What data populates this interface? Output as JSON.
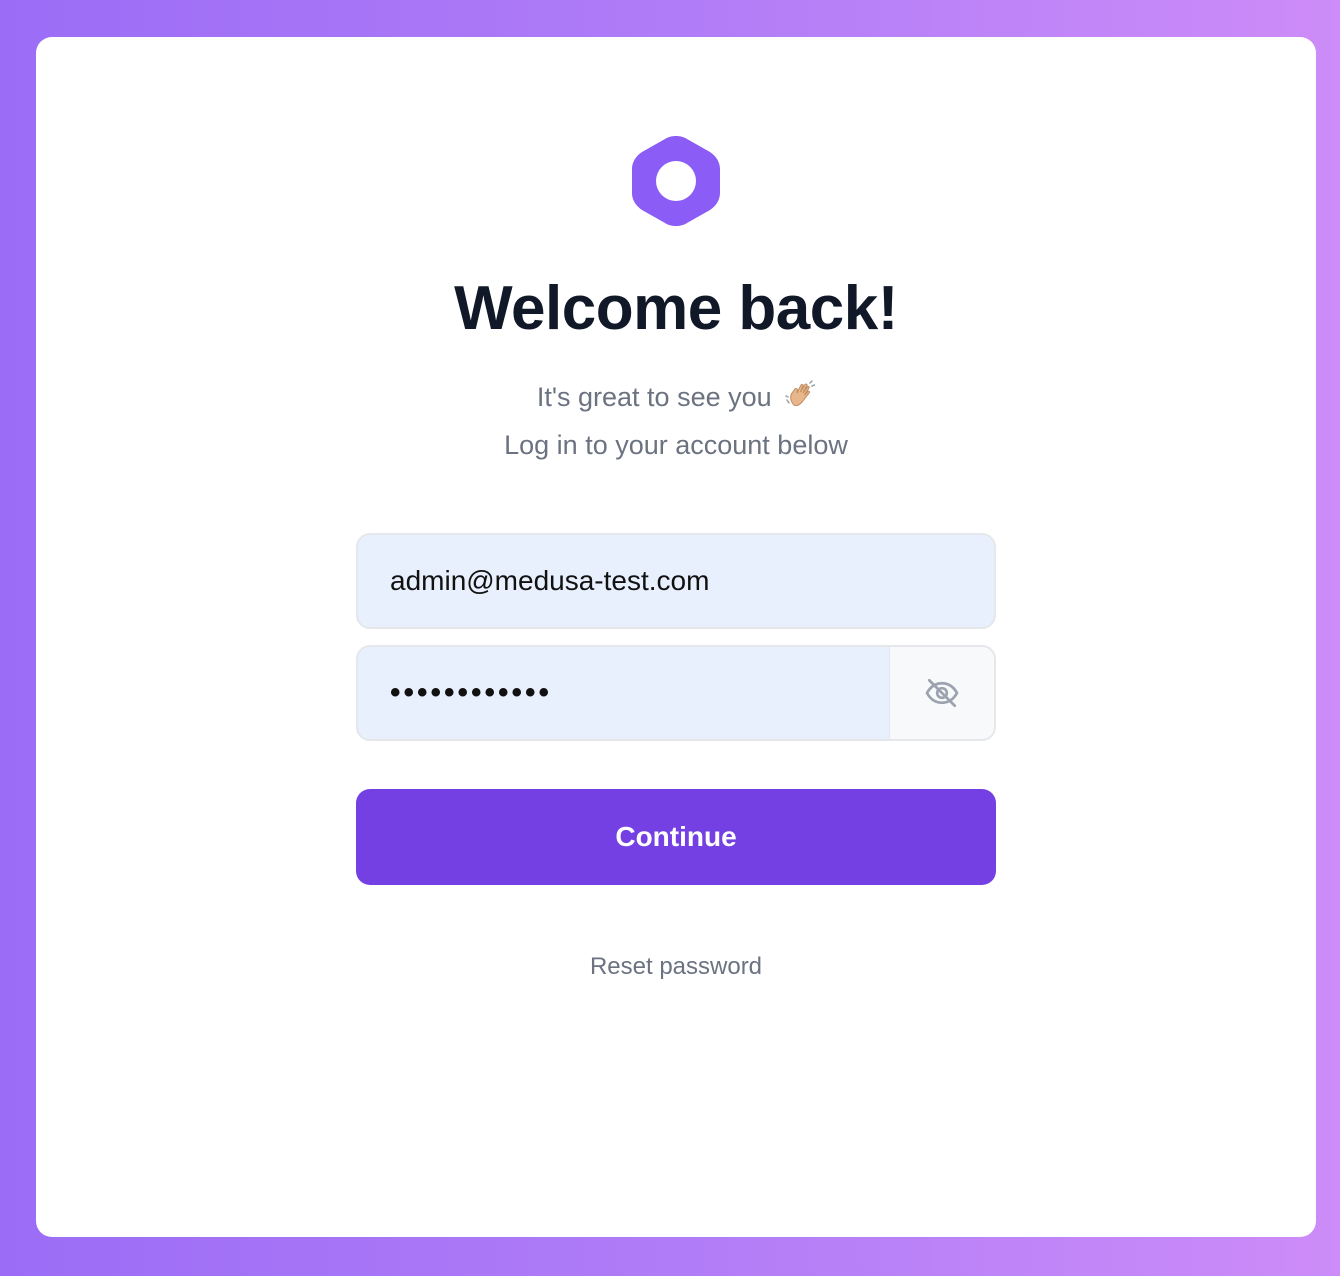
{
  "brand": {
    "accent_color": "#8b5cf6",
    "button_color": "#7440e4",
    "logo_icon": "hexagon-logo-icon"
  },
  "login": {
    "title": "Welcome back!",
    "subtitle_line1": "It's great to see you",
    "subtitle_emoji": "waving-hand-icon",
    "subtitle_line2": "Log in to your account below",
    "email_value": "admin@medusa-test.com",
    "password_value": "............",
    "password_toggle_icon": "eye-off-icon",
    "continue_label": "Continue",
    "reset_label": "Reset password"
  }
}
